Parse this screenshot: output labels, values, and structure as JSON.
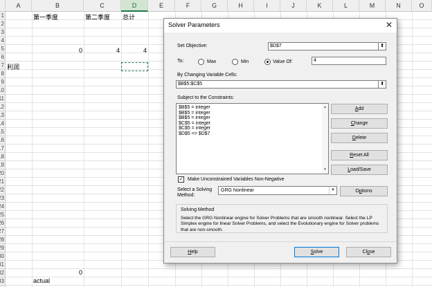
{
  "sheet": {
    "columns": [
      "A",
      "B",
      "C",
      "D",
      "E",
      "F",
      "G",
      "H",
      "I",
      "J",
      "K",
      "L",
      "M",
      "N",
      "O"
    ],
    "rows": [
      "1",
      "2",
      "3",
      "4",
      "5",
      "6",
      "7",
      "8",
      "9",
      "10",
      "11",
      "12",
      "13",
      "14",
      "15",
      "16",
      "17",
      "18",
      "19",
      "20",
      "21",
      "22",
      "23",
      "24",
      "25",
      "26",
      "27",
      "28",
      "29",
      "30",
      "31",
      "32",
      "33",
      "34"
    ],
    "cells": {
      "b1": "第一季度",
      "c1": "第二季度",
      "d1": "总计",
      "b5": "0",
      "c5": "4",
      "d5": "4",
      "a7": "利润",
      "b33": "0",
      "b34": "actual"
    }
  },
  "dialog": {
    "title": "Solver Parameters",
    "close_icon": "close-icon",
    "set_objective_label": "Set Objective:",
    "objective_value": "$D$7",
    "to_label": "To:",
    "max_label": "Max",
    "min_label": "Min",
    "value_of_label": "Value Of:",
    "value_of_value": "4",
    "to_selected": "Value Of",
    "changing_label": "By Changing Variable Cells:",
    "changing_value": "$B$5:$C$5",
    "constraints_label": "Subject to the Constraints:",
    "constraints": [
      "$B$5 = integer",
      "$B$5 = integer",
      "$B$5 = integer",
      "$C$5 = integer",
      "$C$5 = integer",
      "$D$5 <= $D$7"
    ],
    "buttons": {
      "add": "Add",
      "change": "Change",
      "delete": "Delete",
      "reset_all": "Reset All",
      "load_save": "Load/Save",
      "options": "Options",
      "help": "Help",
      "solve": "Solve",
      "close": "Close"
    },
    "nonneg_label": "Make Unconstrained Variables Non-Negative",
    "nonneg_checked": true,
    "method_label_1": "Select a Solving",
    "method_label_2": "Method:",
    "method_value": "GRG Nonlinear",
    "method_group_title": "Solving Method",
    "method_description": "Select the GRG Nonlinear engine for Solver Problems that are smooth nonlinear. Select the LP Simplex engine for linear Solver Problems, and select the Evolutionary engine for Solver problems that are non-smooth."
  },
  "colors": {
    "excel_green": "#217346",
    "default_button_border": "#0078d7"
  }
}
